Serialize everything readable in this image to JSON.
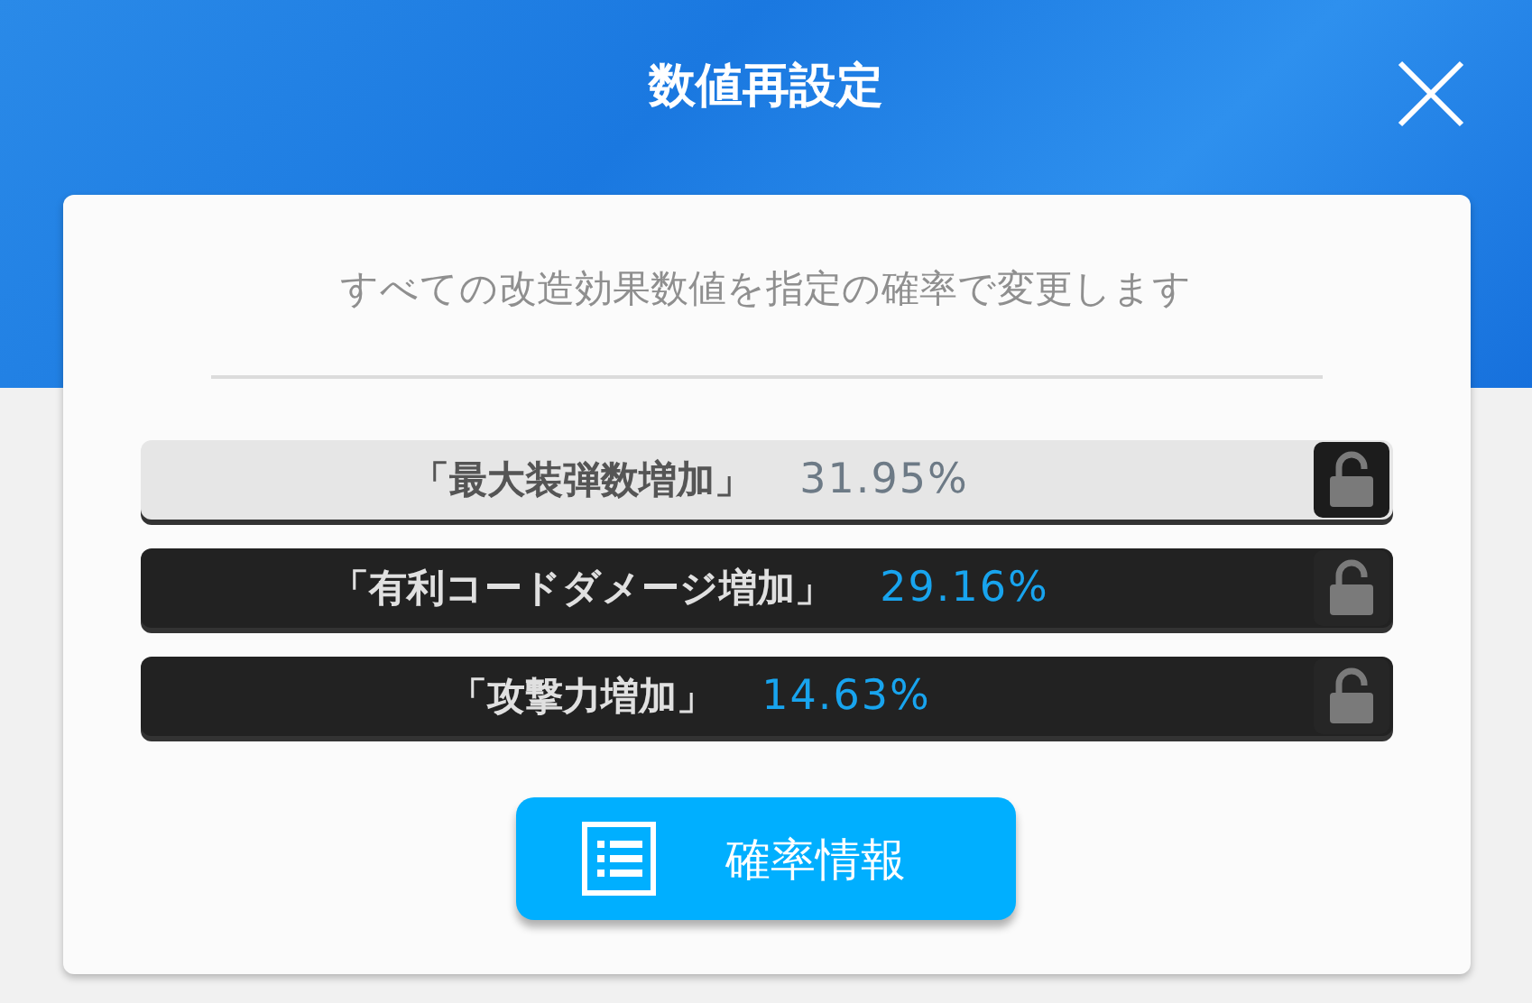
{
  "dialog": {
    "title": "数値再設定",
    "description": "すべての改造効果数値を指定の確率で変更します",
    "effects": [
      {
        "name": "「最大装弾数増加」",
        "value": "31.95%",
        "selected": true,
        "locked": false
      },
      {
        "name": "「有利コードダメージ増加」",
        "value": "29.16%",
        "selected": false,
        "locked": false
      },
      {
        "name": "「攻撃力増加」",
        "value": "14.63%",
        "selected": false,
        "locked": false
      }
    ],
    "button": "確率情報"
  }
}
